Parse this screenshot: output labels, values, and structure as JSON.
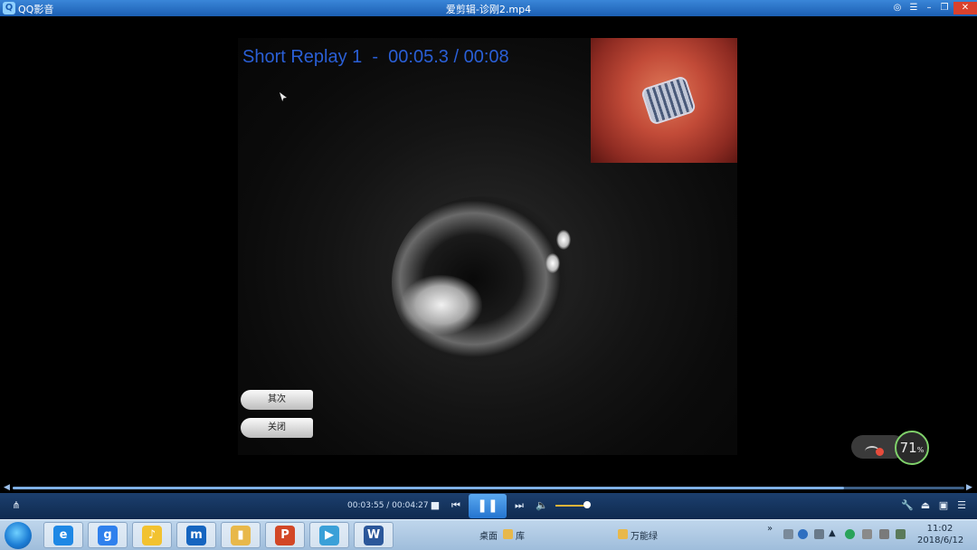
{
  "window": {
    "app_name": "QQ影音",
    "title": "爱剪辑-诊刚2.mp4",
    "buttons": {
      "skin": "◎",
      "menu": "☰",
      "minimize": "–",
      "restore": "❐",
      "close": "✕"
    }
  },
  "video": {
    "overlay_text": "Short Replay 1  -  00:05.3 / 00:08",
    "overlay_color": "#2a5fd6",
    "buttons": [
      "其次",
      "关闭"
    ]
  },
  "network_widget": {
    "percent": "71",
    "unit": "%"
  },
  "seek": {
    "progress_fraction": 0.874
  },
  "controls": {
    "time": "00:03:55 / 00:04:27",
    "volume_fraction": 0.85
  },
  "taskbar": {
    "items": [
      {
        "name": "ie",
        "glyph": "e",
        "color": "#1e88e5"
      },
      {
        "name": "baidu",
        "glyph": "g",
        "color": "#2f80ed"
      },
      {
        "name": "qq-music",
        "glyph": "♪",
        "color": "#f2c230"
      },
      {
        "name": "maxthon",
        "glyph": "m",
        "color": "#1565c0"
      },
      {
        "name": "folder",
        "glyph": "▮",
        "color": "#e8b84a"
      },
      {
        "name": "powerpoint",
        "glyph": "P",
        "color": "#d24726"
      },
      {
        "name": "qq-player",
        "glyph": "▶",
        "color": "#3aa0d8"
      },
      {
        "name": "word",
        "glyph": "W",
        "color": "#2b579a"
      }
    ],
    "toolbar_labels": {
      "desktop": "桌面",
      "library": "库"
    },
    "pinned_label": "万能绿",
    "clock_time": "11:02",
    "clock_date": "2018/6/12"
  }
}
